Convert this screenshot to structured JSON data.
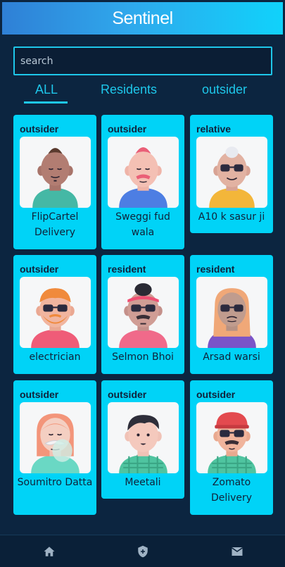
{
  "header": {
    "title": "Sentinel"
  },
  "search": {
    "placeholder": "search"
  },
  "tabs": [
    {
      "label": "ALL",
      "active": true
    },
    {
      "label": "Residents",
      "active": false
    },
    {
      "label": "outsider",
      "active": false
    }
  ],
  "cards": [
    {
      "tag": "outsider",
      "name": "FlipCartel Delivery",
      "avatar": "avatar-mohawk-man"
    },
    {
      "tag": "outsider",
      "name": "Sweggi fud wala",
      "avatar": "avatar-pink-hair-man"
    },
    {
      "tag": "relative",
      "name": "A10 k sasur ji",
      "avatar": "avatar-old-man-glasses"
    },
    {
      "tag": "outsider",
      "name": "electrician",
      "avatar": "avatar-orange-beard-man"
    },
    {
      "tag": "resident",
      "name": "Selmon Bhoi",
      "avatar": "avatar-headband-man"
    },
    {
      "tag": "resident",
      "name": "Arsad warsi",
      "avatar": "avatar-long-hair-glasses"
    },
    {
      "tag": "outsider",
      "name": "Soumitro Datta",
      "avatar": "avatar-mustache-girl"
    },
    {
      "tag": "outsider",
      "name": "Meetali",
      "avatar": "avatar-dark-hair-man"
    },
    {
      "tag": "outsider",
      "name": "Zomato Delivery",
      "avatar": "avatar-cap-man"
    }
  ],
  "bottom_nav": [
    {
      "icon": "home-icon"
    },
    {
      "icon": "shield-icon"
    },
    {
      "icon": "mail-icon"
    }
  ],
  "colors": {
    "accent": "#1ec7ea",
    "card": "#00d3f7",
    "background": "#0c2540"
  }
}
